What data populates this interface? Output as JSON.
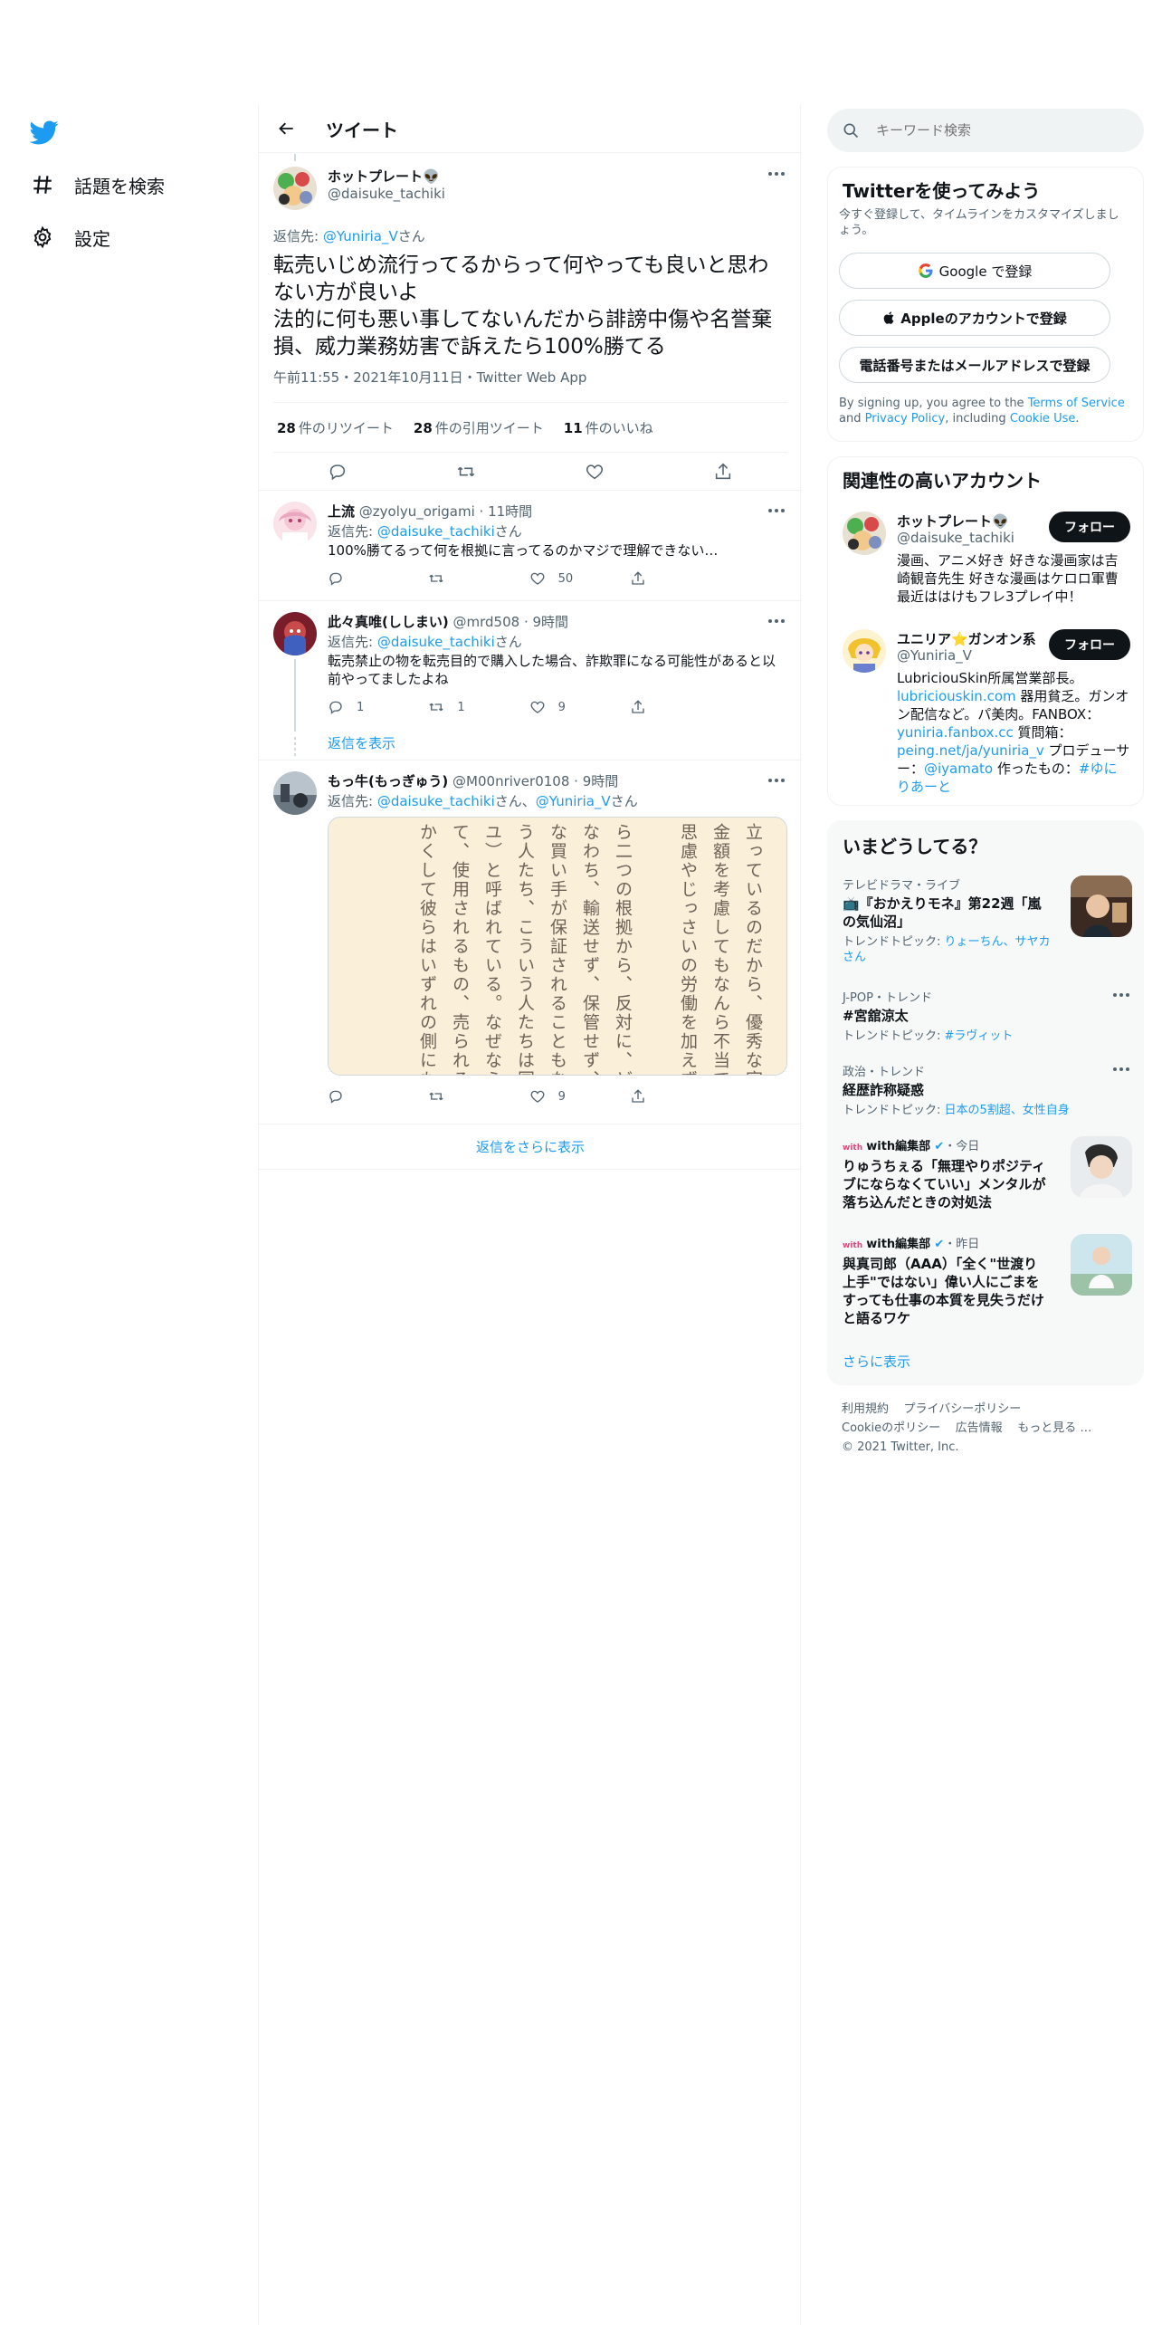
{
  "nav": {
    "items": [
      {
        "label": "話題を検索",
        "icon": "hashtag-icon"
      },
      {
        "label": "設定",
        "icon": "gear-icon"
      }
    ]
  },
  "header": {
    "title": "ツイート"
  },
  "main_tweet": {
    "name": "ホットプレート👽",
    "handle": "@daisuke_tachiki",
    "reply_prefix": "返信先: ",
    "reply_to": "@Yuniria_V",
    "reply_suffix": "さん",
    "text": "転売いじめ流行ってるからって何やっても良いと思わない方が良いよ\n法的に何も悪い事してないんだから誹謗中傷や名誉棄損、威力業務妨害で訴えたら100%勝てる",
    "meta": "午前11:55・2021年10月11日・Twitter Web App",
    "retweets_count": "28",
    "retweets_label": "件のリツイート",
    "quotes_count": "28",
    "quotes_label": "件の引用ツイート",
    "likes_count": "11",
    "likes_label": "件のいいね"
  },
  "replies": [
    {
      "name": "上流",
      "handle": "@zyolyu_origami",
      "time": "11時間",
      "reply_prefix": "返信先: ",
      "reply_to": "@daisuke_tachiki",
      "reply_suffix": "さん",
      "text": "100%勝てるって何を根拠に言ってるのかマジで理解できない…",
      "reply_count": "",
      "retweet_count": "",
      "like_count": "50"
    },
    {
      "name": "此々真唯(ししまい)",
      "handle": "@mrd508",
      "time": "9時間",
      "reply_prefix": "返信先: ",
      "reply_to": "@daisuke_tachiki",
      "reply_suffix": "さん",
      "text": "転売禁止の物を転売目的で購入した場合、詐欺罪になる可能性があると以前やってましたよね",
      "reply_count": "1",
      "retweet_count": "1",
      "like_count": "9",
      "show_replies": "返信を表示"
    },
    {
      "name": "もっ牛(もっぎゅう)",
      "handle": "@M00nriver0108",
      "time": "9時間",
      "reply_prefix": "返信先: ",
      "reply_to": "@daisuke_tachiki",
      "reply_mid": "さん、",
      "reply_to2": "@Yuniria_V",
      "reply_suffix": "さん",
      "image_columns": [
        "立っているのだから、優秀な官吏に",
        "金額を考慮してもなんら不当ではな",
        "思慮やじっさいの労働を加えずに儲",
        "",
        "ら二つの根拠から、反対に、どのよ",
        "なわち、輸送せず、保管せず、勤勉",
        "な買い手が保証されることもなく、",
        "う人たち、こういう人たちは国家に",
        "ユ）と呼ばれている。なぜなら彼ら",
        "て、使用されるもの、売られるもの",
        "かくして彼らはいずれの側にも損害"
      ],
      "reply_count": "",
      "retweet_count": "",
      "like_count": "9"
    }
  ],
  "more_replies": "返信をさらに表示",
  "search": {
    "placeholder": "キーワード検索"
  },
  "signup": {
    "title": "Twitterを使ってみよう",
    "subtitle": "今すぐ登録して、タイムラインをカスタマイズしましょう。",
    "google": "Google で登録",
    "apple": "Appleのアカウントで登録",
    "phone": "電話番号またはメールアドレスで登録",
    "legal_1": "By signing up, you agree to the ",
    "tos": "Terms of Service",
    "legal_2": " and ",
    "privacy": "Privacy Policy",
    "legal_3": ", including ",
    "cookie": "Cookie Use",
    "legal_4": "."
  },
  "related": {
    "title": "関連性の高いアカウント",
    "follow_label": "フォロー",
    "accounts": [
      {
        "name": "ホットプレート👽",
        "handle": "@daisuke_tachiki",
        "bio": "漫画、アニメ好き 好きな漫画家は吉崎観音先生 好きな漫画はケロロ軍曹 最近ははけもフレ3プレイ中！"
      },
      {
        "name": "ユニリア⭐ガンオン系",
        "handle": "@Yuniria_V",
        "bio_1": "LubriciouSkin所属営業部長。",
        "bio_link1": "lubriciouskin.com",
        "bio_2": " 器用貧乏。ガンオン配信など。パ美肉。FANBOX：",
        "bio_link2": "yuniria.fanbox.cc",
        "bio_3": " 質問箱：",
        "bio_link3": "peing.net/ja/yuniria_v",
        "bio_4": " プロデューサー：",
        "bio_link4": "@iyamato",
        "bio_5": " 作ったもの：",
        "bio_link5": "#ゆにりあーと"
      }
    ]
  },
  "trends": {
    "title": "いまどうしてる？",
    "items": [
      {
        "category": "テレビドラマ・ライブ",
        "title": "📺『おかえりモネ』第22週「嵐の気仙沼」",
        "sub_prefix": "トレンドトピック: ",
        "sub_link": "りょーちん、サヤカさん"
      },
      {
        "category": "J-POP・トレンド",
        "title": "#宮舘涼太",
        "sub_prefix": "トレンドトピック: ",
        "sub_link": "#ラヴィット"
      },
      {
        "category": "政治・トレンド",
        "title": "経歴詐称疑惑",
        "sub_prefix": "トレンドトピック: ",
        "sub_link": "日本の5割超、女性自身"
      },
      {
        "source": "with編集部",
        "time": "・今日",
        "title": "りゅうちぇる「無理やりポジティブにならなくていい」メンタルが落ち込んだときの対処法"
      },
      {
        "source": "with編集部",
        "time": "・昨日",
        "title": "與真司郎（AAA）「全く\"世渡り上手\"ではない」偉い人にごまをすっても仕事の本質を見失うだけと語るワケ"
      }
    ],
    "show_more": "さらに表示"
  },
  "footer": {
    "links": [
      "利用規約",
      "プライバシーポリシー",
      "Cookieのポリシー",
      "広告情報",
      "もっと見る …"
    ],
    "copyright": "© 2021 Twitter, Inc."
  },
  "colors": {
    "accent": "#1d9bf0",
    "text": "#0f1419",
    "muted": "#536471",
    "border": "#eff3f4",
    "image_bg": "#faefd9"
  }
}
